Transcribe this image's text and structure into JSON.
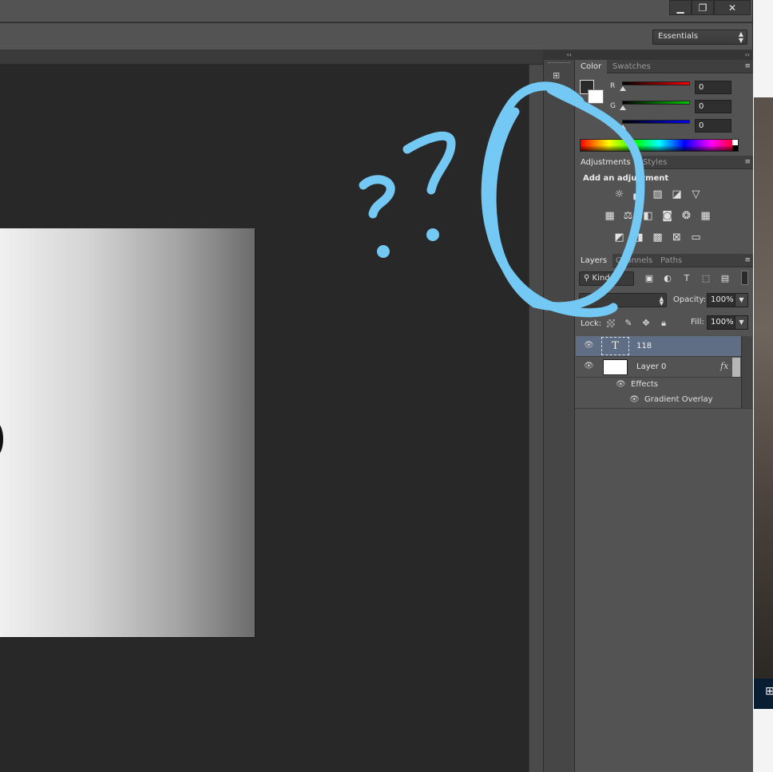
{
  "window": {
    "minimize_glyph": "▁",
    "restore_glyph": "❐",
    "close_glyph": "✕"
  },
  "options_bar": {
    "workspace_label": "Essentials"
  },
  "panels": {
    "collapse_glyph": "‹‹",
    "expand_glyph": "››",
    "menu_glyph": "≡",
    "color": {
      "tabs": [
        "Color",
        "Swatches"
      ],
      "channels": [
        {
          "label": "R",
          "value": "0",
          "color": "#ff0000"
        },
        {
          "label": "G",
          "value": "0",
          "color": "#00cc00"
        },
        {
          "label": "B",
          "value": "0",
          "color": "#0000ff"
        }
      ]
    },
    "adjustments": {
      "tabs": [
        "Adjustments",
        "Styles"
      ],
      "heading": "Add an adjustment",
      "icons": [
        "brightness-contrast-icon",
        "levels-icon",
        "curves-icon",
        "exposure-icon",
        "vibrance-icon",
        "hue-saturation-icon",
        "color-balance-icon",
        "black-white-icon",
        "photo-filter-icon",
        "channel-mixer-icon",
        "color-lookup-icon",
        "invert-icon",
        "posterize-icon",
        "threshold-icon",
        "selective-color-icon",
        "gradient-map-icon"
      ]
    },
    "layers": {
      "tabs": [
        "Layers",
        "Channels",
        "Paths"
      ],
      "kind_label": "Kind",
      "opacity_label": "Opacity:",
      "opacity_value": "100%",
      "lock_label": "Lock:",
      "fill_label": "Fill:",
      "fill_value": "100%",
      "items": [
        {
          "name": "118",
          "type": "text",
          "thumb_glyph": "T",
          "selected": true
        },
        {
          "name": "Layer 0",
          "type": "image",
          "fx_label": "fx",
          "selected": false,
          "effects_label": "Effects",
          "effects": [
            "Gradient Overlay"
          ]
        }
      ]
    }
  },
  "annotation": {
    "color": "#74c8f4",
    "marks": "??"
  },
  "taskbar": {
    "start_glyph": "⊞"
  }
}
